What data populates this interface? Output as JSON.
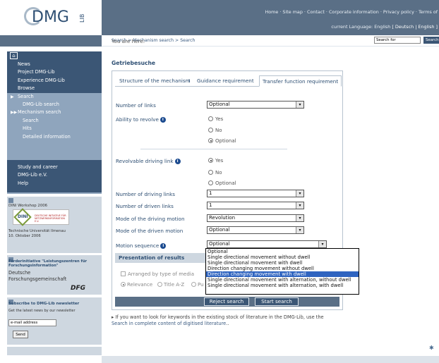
{
  "logo": {
    "text": "DMG",
    "sub": "LIB"
  },
  "header": {
    "top_links": "Home · Site map · Contact · Corporate information · Privacy policy · Terms of",
    "language_label": "current Language: English",
    "languages": "[ Deutsch | English ]"
  },
  "breadcrumb": {
    "label": "You are here:",
    "items": [
      "Search",
      "Mechanism search",
      "Search"
    ],
    "sep": ">"
  },
  "search": {
    "placeholder": "Search for",
    "value": "Search for",
    "button": "Search"
  },
  "nav": {
    "items": [
      "News",
      "Project DMG-Lib",
      "Experience DMG-Lib",
      "Browse",
      "Search",
      "DMG-Lib search",
      "Mechanism search",
      "Search",
      "Hits",
      "Detailed information"
    ],
    "items2": [
      "Study and career",
      "DMG-Lib e.V.",
      "Help"
    ]
  },
  "dini": {
    "title": "DINI Workshop 2006",
    "badge": "DINI",
    "badge_sub": "DEUTSCHE INITIATIVE FÜR NETZWERKINFORMATION E.V.",
    "text1": "Technische Universität Ilmenau",
    "text2": "10. Oktober 2006"
  },
  "dfg": {
    "title1": "Förderinitiative \"Leistungszentren für",
    "title2": "Forschungsinformation\"",
    "text1": "Deutsche",
    "text2": "Forschungsgemeinschaft",
    "logo": "DFG"
  },
  "newsletter": {
    "title": "Subscribe to DMG-Lib newsletter",
    "text": "Get the latest news by our newsletter",
    "placeholder": "e-mail address",
    "button": "Send"
  },
  "main": {
    "title": "Getriebesuche",
    "tabs": [
      "Structure of the mechanism",
      "Guidance requirement",
      "Transfer function requirement"
    ],
    "tab_sep": "I",
    "fields": {
      "links_label": "Number of links",
      "links_value": "Optional",
      "revolve_label": "Ability to revolve",
      "revolvable_label": "Revolvable driving link",
      "driving_links_label": "Number of driving links",
      "driving_links_value": "1",
      "driven_links_label": "Number of driven links",
      "driven_links_value": "1",
      "driving_motion_label": "Mode of the driving motion",
      "driving_motion_value": "Revolution",
      "driven_motion_label": "Mode of the driven motion",
      "driven_motion_value": "Optional",
      "motion_seq_label": "Motion sequence",
      "motion_seq_value": "Optional"
    },
    "radios": {
      "yes": "Yes",
      "no": "No",
      "optional": "Optional"
    },
    "revolve_selected": "optional",
    "revolvable_selected": "yes",
    "info_icon": "i",
    "arrow": "▾",
    "presentation": {
      "title": "Presentation of results",
      "arranged": "Arranged by type of media",
      "relevance": "Relevance",
      "title_az": "Title A-Z",
      "pu": "Pu"
    },
    "buttons": {
      "reject": "Reject search",
      "start": "Start search"
    },
    "dropdown_options": [
      "Optional",
      "Single directional movement without dwell",
      "Single directional movement with dwell",
      "Direction changing movement without dwell",
      "Direction changing movement with dwell",
      "Single directional movement with alternation, without dwell",
      "Single directional movement with alternation, with dwell"
    ],
    "dropdown_highlight_index": 4
  },
  "note": {
    "text": "▸ If you want to look for keywords in the existing stock of literature in the DMG-Lib, use the",
    "link": "Search in complete content of digitised literature",
    "tail": ".."
  },
  "colors": {
    "dark_blue": "#3b5675",
    "mid_blue": "#5a6f86",
    "light_panel": "#ced7e0",
    "nav": "#8fa5bd",
    "highlight": "#2f64c0"
  }
}
